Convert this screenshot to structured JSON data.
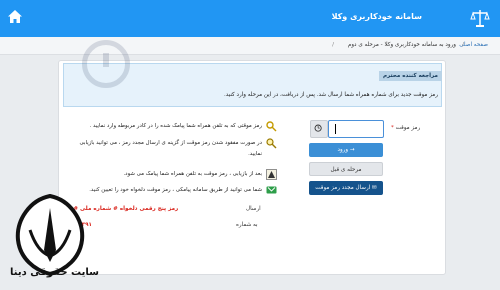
{
  "header": {
    "brand": "سامانه خودکاربری وکلا",
    "home_icon": "home-icon",
    "logo_icon": "scales-of-justice-icon",
    "bar_color": "#2196f3"
  },
  "breadcrumb": {
    "items": [
      "صفحه اصلی",
      "ورود به سامانه خودکاربری وکلا - مرحله ی دوم",
      "-"
    ]
  },
  "notice": {
    "title": "مراجعه کننده محترم",
    "text": "رمز موقت جدید برای شماره همراه شما ارسال شد. پس از دریافت، در این مرحله وارد کنید."
  },
  "info": {
    "lines": [
      "رمز موقتی که به تلفن همراه شما پیامک شده را در کادر مربوطه وارد نمایید .",
      "در صورت مفقود شدن رمز موقت از گزینه ی ارسال مجدد رمز ، می توانید بازیابی",
      "نمایید.",
      "بعد از بازیابی ، رمز موقت به تلفن همراه شما پیامک می شود.",
      "شما می توانید از طریق سامانه پیامکی ، رمز موقت دلخواه خود را تعیین کنید."
    ]
  },
  "form": {
    "password_label": "رمز موقت",
    "required_mark": "*",
    "password_value": "",
    "login_button": "ورود",
    "back_button": "مرحله ی قبل",
    "resend_button": "ارسال مجدد رمز موقت"
  },
  "sms": {
    "send_label": "ارسال",
    "to_number_label": "به شماره",
    "code_text": "رمز پنج رقمی دلخواه # شماره ملی # ۵",
    "number_text": "۱۰۰۰۳۹۱"
  },
  "watermark": {
    "site_name": "سایت حقوقی دینا"
  }
}
